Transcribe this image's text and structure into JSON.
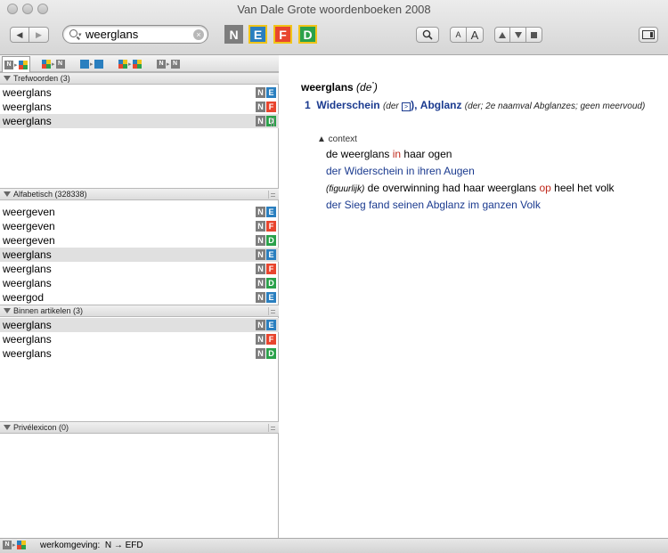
{
  "window": {
    "title": "Van Dale Grote woordenboeken 2008"
  },
  "toolbar": {
    "back_icon": "◀",
    "forward_icon": "▶",
    "search_value": "weerglans",
    "lang_n": "N",
    "lang_e": "E",
    "lang_f": "F",
    "lang_d": "D",
    "font_small": "A",
    "font_large": "A"
  },
  "colors": {
    "E": "#2a7fbf",
    "F": "#e8452e",
    "D": "#2aa14a",
    "N": "#7d7d7d",
    "selected": "#f0c419"
  },
  "mode_tabs": [
    "N→EFD",
    "EFD→N",
    "N→E",
    "N→F",
    "N→D"
  ],
  "sections": {
    "trefwoorden": {
      "header": "Trefwoorden (3)",
      "rows": [
        {
          "word": "weerglans",
          "lang": "E"
        },
        {
          "word": "weerglans",
          "lang": "F"
        },
        {
          "word": "weerglans",
          "lang": "D"
        }
      ]
    },
    "alfabetisch": {
      "header": "Alfabetisch (328338)",
      "rows": [
        {
          "word": "weergeven",
          "lang": "E"
        },
        {
          "word": "weergeven",
          "lang": "F"
        },
        {
          "word": "weergeven",
          "lang": "D"
        },
        {
          "word": "weerglans",
          "lang": "E"
        },
        {
          "word": "weerglans",
          "lang": "F"
        },
        {
          "word": "weerglans",
          "lang": "D"
        },
        {
          "word": "weergod",
          "lang": "E"
        }
      ]
    },
    "binnen": {
      "header": "Binnen artikelen (3)",
      "rows": [
        {
          "word": "weerglans",
          "lang": "E"
        },
        {
          "word": "weerglans",
          "lang": "F"
        },
        {
          "word": "weerglans",
          "lang": "D"
        }
      ]
    },
    "prive": {
      "header": "Privélexicon (0)"
    }
  },
  "article": {
    "headword": "weerglans",
    "genus": "(de",
    "genus_close": ")",
    "sense_num": "1",
    "tr1": "Widerschein",
    "tr1_gram": "(der",
    "tr1_close": "),",
    "tr2": "Abglanz",
    "tr2_gram": "(der; 2e naamval Abglanzes; geen meervoud)",
    "context_label": "▲ context",
    "ex1_a": "de weerglans ",
    "ex1_b": "in",
    "ex1_c": " haar ogen",
    "ex1_tr": "der Widerschein in ihren Augen",
    "ex2_note": "(figuurlijk)",
    "ex2_a": " de overwinning had haar weerglans ",
    "ex2_b": "op",
    "ex2_c": " heel het volk",
    "ex2_tr": "der Sieg fand seinen Abglanz im ganzen Volk"
  },
  "status": {
    "label": "werkomgeving:",
    "value": "N → EFD"
  }
}
